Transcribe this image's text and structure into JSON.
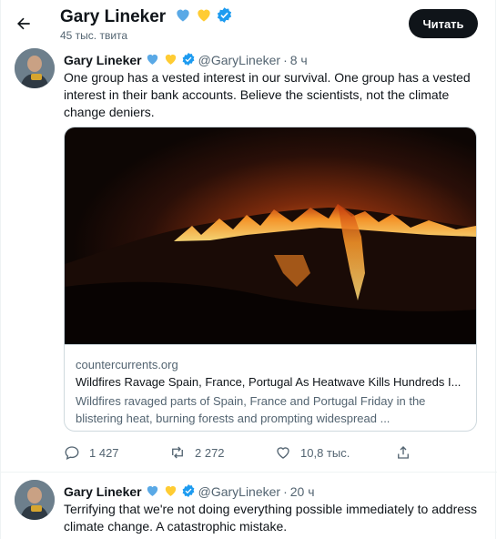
{
  "header": {
    "back_icon": "arrow-left-icon",
    "name": "Gary Lineker",
    "hearts": [
      "#1d9bf0",
      "#ffd43b"
    ],
    "verified_icon": "verified-badge-icon",
    "tweet_count": "45 тыс. твита",
    "follow_label": "Читать"
  },
  "colors": {
    "accent": "#1d9bf0",
    "dark": "#0f1419",
    "secondary": "#536471",
    "border": "#cfd9de"
  },
  "tweets": [
    {
      "name": "Gary Lineker",
      "handle": "@GaryLineker",
      "dot": "·",
      "time": "8 ч",
      "text": "One group has a vested interest in our survival. One group has a vested interest in their bank accounts. Believe the scientists, not the climate change deniers.",
      "card": {
        "domain": "countercurrents.org",
        "title": "Wildfires Ravage Spain, France, Portugal As Heatwave Kills Hundreds I...",
        "description": "Wildfires ravaged parts of Spain, France and Portugal Friday in the blistering heat, burning forests and prompting widespread ..."
      },
      "actions": {
        "reply_icon": "reply-icon",
        "replies": "1 427",
        "retweet_icon": "retweet-icon",
        "retweets": "2 272",
        "like_icon": "heart-icon",
        "likes": "10,8 тыс.",
        "share_icon": "share-icon"
      }
    },
    {
      "name": "Gary Lineker",
      "handle": "@GaryLineker",
      "dot": "·",
      "time": "20 ч",
      "text": "Terrifying that we're not doing everything possible immediately to address climate change. A catastrophic mistake."
    }
  ]
}
